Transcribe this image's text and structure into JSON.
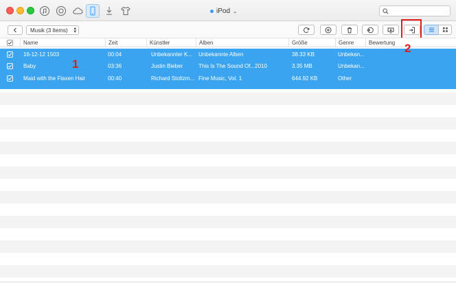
{
  "window": {
    "device_name": "iPod"
  },
  "search": {
    "placeholder": ""
  },
  "toolbar": {
    "category_label": "Musik (3 Items)"
  },
  "table": {
    "columns": [
      "Name",
      "Zeit",
      "Künstler",
      "Alben",
      "Größe",
      "Genre",
      "Bewertung"
    ],
    "rows": [
      {
        "name": "16-12-12 1503",
        "time": "00:04",
        "artist": "Unbekannter K...",
        "album": "Unbekannte Alben",
        "size": "38.33 KB",
        "genre": "Unbekan..."
      },
      {
        "name": "Baby",
        "time": "03:36",
        "artist": "Justin Bieber",
        "album": "This Is The Sound Of...2010",
        "size": "3.35 MB",
        "genre": "Unbekan..."
      },
      {
        "name": "Maid with the Flaxen Hair",
        "time": "00:40",
        "artist": "Richard Stoltzm...",
        "album": "Fine Music, Vol. 1",
        "size": "644.92 KB",
        "genre": "Other"
      }
    ]
  },
  "annotations": {
    "one": "1",
    "two": "2"
  },
  "colors": {
    "selection": "#3aa4f0",
    "highlight": "#e21b1b",
    "accent": "#3b99fc"
  }
}
